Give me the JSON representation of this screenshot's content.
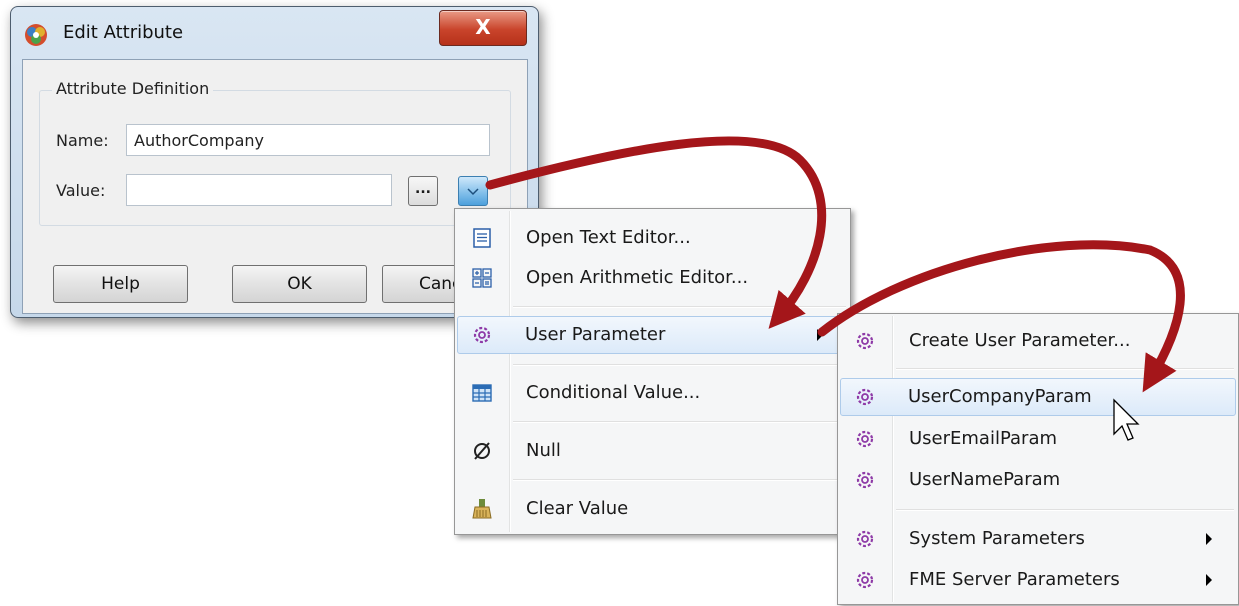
{
  "dialog": {
    "title": "Edit Attribute",
    "close_label": "X",
    "group_title": "Attribute Definition",
    "name_label": "Name:",
    "name_value": "AuthorCompany",
    "value_label": "Value:",
    "value_value": "",
    "browse_label": "...",
    "help_label": "Help",
    "ok_label": "OK",
    "cancel_label": "Canc"
  },
  "context_menu": {
    "items": [
      {
        "label": "Open Text Editor...",
        "icon": "text-editor-icon"
      },
      {
        "label": "Open Arithmetic Editor...",
        "icon": "arithmetic-editor-icon"
      },
      {
        "label": "User Parameter",
        "icon": "user-parameter-icon",
        "submenu": true,
        "highlighted": true
      },
      {
        "label": "Conditional Value...",
        "icon": "table-icon"
      },
      {
        "label": "Null",
        "icon": "null-icon"
      },
      {
        "label": "Clear Value",
        "icon": "broom-icon"
      }
    ]
  },
  "submenu": {
    "items": [
      {
        "label": "Create User Parameter...",
        "icon": "gear-icon"
      },
      {
        "label": "UserCompanyParam",
        "icon": "gear-icon",
        "highlighted": true
      },
      {
        "label": "UserEmailParam",
        "icon": "gear-icon"
      },
      {
        "label": "UserNameParam",
        "icon": "gear-icon"
      },
      {
        "label": "System Parameters",
        "icon": "gear-icon",
        "submenu": true
      },
      {
        "label": "FME Server Parameters",
        "icon": "gear-icon",
        "submenu": true
      }
    ]
  },
  "colors": {
    "arrow": "#a4161a",
    "gear": "#8e3aa7",
    "highlight_border": "#aecbea"
  }
}
